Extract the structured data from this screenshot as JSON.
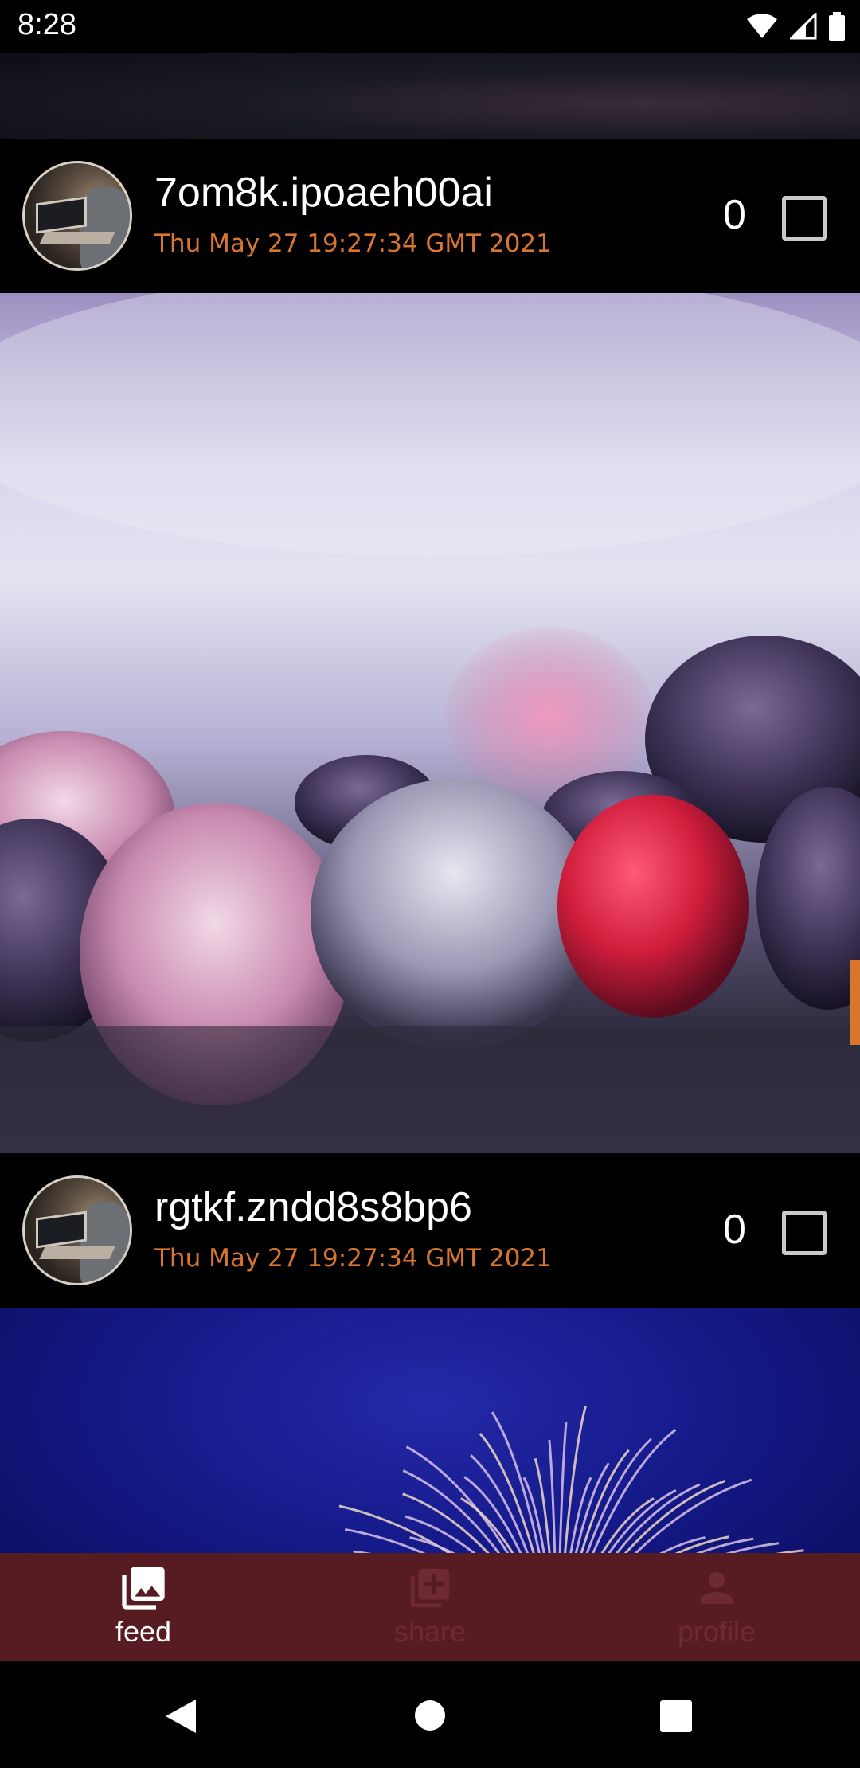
{
  "status_bar": {
    "time": "8:28",
    "icons": [
      "wifi-icon",
      "cellular-signal-icon",
      "battery-icon"
    ]
  },
  "posts": [
    {
      "username": "7om8k.ipoaeh00ai",
      "timestamp": "Thu May 27 19:27:34 GMT 2021",
      "likes": "0",
      "checked": false,
      "image": "frozen-berries-photo"
    },
    {
      "username": "rgtkf.zndd8s8bp6",
      "timestamp": "Thu May 27 19:27:34 GMT 2021",
      "likes": "0",
      "checked": false,
      "image": "fireworks-photo"
    }
  ],
  "bottom_nav": {
    "items": [
      {
        "label": "feed",
        "icon": "photo-library-icon",
        "active": true
      },
      {
        "label": "share",
        "icon": "add-to-photos-icon",
        "active": false
      },
      {
        "label": "profile",
        "icon": "person-icon",
        "active": false
      }
    ]
  },
  "colors": {
    "accent": "#d8762e",
    "nav_background": "#571b22",
    "background": "#000000"
  }
}
